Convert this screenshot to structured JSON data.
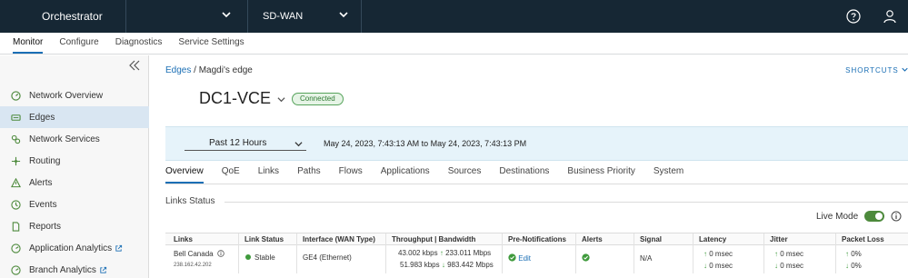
{
  "topbar": {
    "app_title": "Orchestrator",
    "selector_value": "",
    "product": "SD-WAN"
  },
  "main_nav": {
    "tabs": [
      {
        "label": "Monitor",
        "active": true
      },
      {
        "label": "Configure",
        "active": false
      },
      {
        "label": "Diagnostics",
        "active": false
      },
      {
        "label": "Service Settings",
        "active": false
      }
    ]
  },
  "sidebar": {
    "items": [
      {
        "label": "Network Overview",
        "icon": "gauge-icon",
        "active": false
      },
      {
        "label": "Edges",
        "icon": "edge-device-icon",
        "active": true
      },
      {
        "label": "Network Services",
        "icon": "network-services-icon",
        "active": false
      },
      {
        "label": "Routing",
        "icon": "routing-icon",
        "active": false
      },
      {
        "label": "Alerts",
        "icon": "alert-icon",
        "active": false
      },
      {
        "label": "Events",
        "icon": "events-icon",
        "active": false
      },
      {
        "label": "Reports",
        "icon": "report-icon",
        "active": false
      },
      {
        "label": "Application Analytics",
        "icon": "analytics-icon",
        "active": false,
        "external": true
      },
      {
        "label": "Branch Analytics",
        "icon": "analytics-icon",
        "active": false,
        "external": true
      }
    ]
  },
  "breadcrumb": {
    "link": "Edges",
    "separator": " / ",
    "current": "Magdi's edge"
  },
  "shortcuts_label": "SHORTCUTS",
  "edge": {
    "name": "DC1-VCE",
    "status": "Connected"
  },
  "time_filter": {
    "selected": "Past 12 Hours",
    "range": "May 24, 2023, 7:43:13 AM to May 24, 2023, 7:43:13 PM"
  },
  "subtabs": [
    {
      "label": "Overview",
      "active": true
    },
    {
      "label": "QoE",
      "active": false
    },
    {
      "label": "Links",
      "active": false
    },
    {
      "label": "Paths",
      "active": false
    },
    {
      "label": "Flows",
      "active": false
    },
    {
      "label": "Applications",
      "active": false
    },
    {
      "label": "Sources",
      "active": false
    },
    {
      "label": "Destinations",
      "active": false
    },
    {
      "label": "Business Priority",
      "active": false
    },
    {
      "label": "System",
      "active": false
    }
  ],
  "links_status": {
    "title": "Links Status",
    "live_mode_label": "Live Mode",
    "live_mode_on": true,
    "columns": [
      "Links",
      "Link Status",
      "Interface (WAN Type)",
      "Throughput | Bandwidth",
      "Pre-Notifications",
      "Alerts",
      "Signal",
      "Latency",
      "Jitter",
      "Packet Loss"
    ],
    "rows": [
      {
        "link_name": "Bell Canada",
        "link_ip": "238.162.42.202",
        "status": "Stable",
        "interface": "GE4 (Ethernet)",
        "throughput_up": "43.002 kbps",
        "bandwidth_up": "233.011 Mbps",
        "throughput_down": "51.983 kbps",
        "bandwidth_down": "983.442 Mbps",
        "pre_notifications": "Edit",
        "alerts": "enabled",
        "signal": "N/A",
        "latency_up": "0 msec",
        "latency_down": "0 msec",
        "jitter_up": "0 msec",
        "jitter_down": "0 msec",
        "loss_up": "0%",
        "loss_down": "0%"
      }
    ]
  },
  "colors": {
    "topbar_bg": "#162734",
    "accent": "#1b6fb5",
    "status_green": "#3f9a3c",
    "timebar_bg": "#e6f3fa"
  }
}
